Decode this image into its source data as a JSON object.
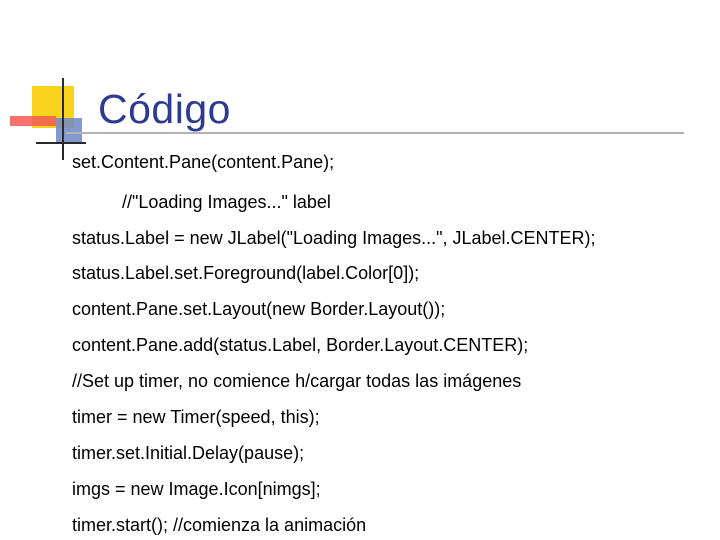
{
  "slide": {
    "title": "Código",
    "lines": [
      "set.Content.Pane(content.Pane);",
      "//\"Loading Images...\" label",
      "status.Label = new JLabel(\"Loading Images...\", JLabel.CENTER);",
      "status.Label.set.Foreground(label.Color[0]);",
      "content.Pane.set.Layout(new Border.Layout());",
      "content.Pane.add(status.Label, Border.Layout.CENTER);",
      "//Set up timer, no comience h/cargar todas las imágenes",
      "timer = new Timer(speed, this);",
      "timer.set.Initial.Delay(pause);",
      "imgs = new Image.Icon[nimgs];",
      "timer.start(); //comienza la animación"
    ]
  },
  "colors": {
    "title": "#2d3a93",
    "accent_yellow": "#f8d21c",
    "accent_red": "#f25c54",
    "accent_blue": "#6f87c8",
    "text": "#000000"
  }
}
